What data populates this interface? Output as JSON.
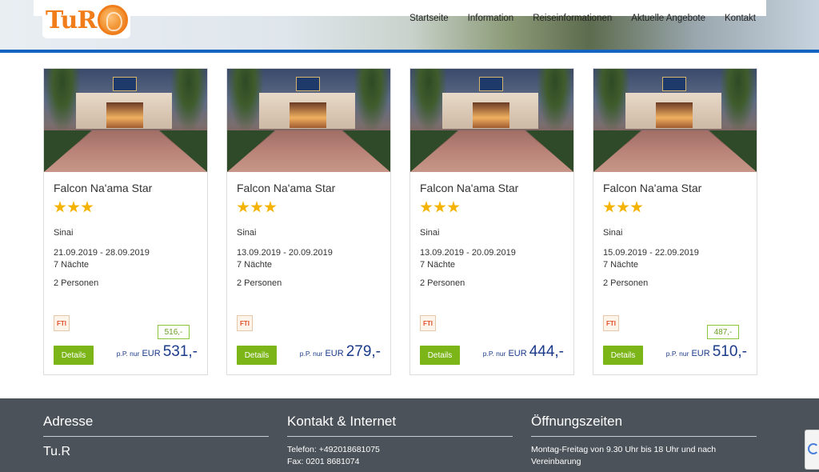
{
  "header": {
    "logo_text": "TuR",
    "nav": [
      "Startseite",
      "Information",
      "Reiseinformationen",
      "Aktuelle Angebote",
      "Kontakt"
    ]
  },
  "cards": [
    {
      "name": "Falcon Na'ama Star",
      "stars": 3,
      "region": "Sinai",
      "dates": "21.09.2019 - 28.09.2019",
      "nights": "7 Nächte",
      "persons": "2 Personen",
      "operator_icon": "FTI",
      "old_price": "516,-",
      "details_label": "Details",
      "price_prefix": "p.P. nur",
      "currency": "EUR",
      "price": "531,-"
    },
    {
      "name": "Falcon Na'ama Star",
      "stars": 3,
      "region": "Sinai",
      "dates": "13.09.2019 - 20.09.2019",
      "nights": "7 Nächte",
      "persons": "2 Personen",
      "operator_icon": "FTI",
      "old_price": "",
      "details_label": "Details",
      "price_prefix": "p.P. nur",
      "currency": "EUR",
      "price": "279,-"
    },
    {
      "name": "Falcon Na'ama Star",
      "stars": 3,
      "region": "Sinai",
      "dates": "13.09.2019 - 20.09.2019",
      "nights": "7 Nächte",
      "persons": "2 Personen",
      "operator_icon": "FTI",
      "old_price": "",
      "details_label": "Details",
      "price_prefix": "p.P. nur",
      "currency": "EUR",
      "price": "444,-"
    },
    {
      "name": "Falcon Na'ama Star",
      "stars": 3,
      "region": "Sinai",
      "dates": "15.09.2019 - 22.09.2019",
      "nights": "7 Nächte",
      "persons": "2 Personen",
      "operator_icon": "FTI",
      "old_price": "487,-",
      "details_label": "Details",
      "price_prefix": "p.P. nur",
      "currency": "EUR",
      "price": "510,-"
    }
  ],
  "footer": {
    "address_title": "Adresse",
    "address_name": "Tu.R",
    "contact_title": "Kontakt & Internet",
    "phone": "Telefon: +492018681075",
    "fax": "Fax: 0201 8681074",
    "hours_title": "Öffnungszeiten",
    "hours_text": "Montag-Freitag von 9.30 Uhr bis 18 Uhr und nach Vereinbarung"
  },
  "colors": {
    "accent_blue": "#1565c0",
    "details_green": "#7cb518",
    "price_blue": "#1a3a8a",
    "star_yellow": "#f5b301",
    "footer_bg": "#4b5259"
  }
}
